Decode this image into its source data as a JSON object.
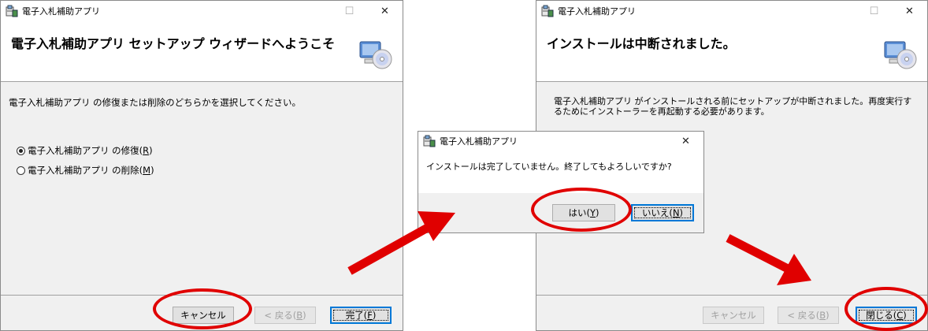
{
  "colors": {
    "highlight": "#e00000",
    "accent": "#0078d7"
  },
  "left_window": {
    "title": "電子入札補助アプリ",
    "header_title": "電子入札補助アプリ セットアップ ウィザードへようこそ",
    "instruction": "電子入札補助アプリ の修復または削除のどちらかを選択してください。",
    "options": [
      {
        "label": "電子入札補助アプリ の修復(",
        "key": "R",
        "selected": true
      },
      {
        "label": "電子入札補助アプリ の削除(",
        "key": "M",
        "selected": false
      }
    ],
    "buttons": {
      "cancel": "キャンセル",
      "back_label": "< 戻る(",
      "back_key": "B",
      "finish_label": "完了(",
      "finish_key": "F"
    }
  },
  "dialog": {
    "title": "電子入札補助アプリ",
    "message": "インストールは完了していません。終了してもよろしいですか?",
    "yes_label": "はい(",
    "yes_key": "Y",
    "no_label": "いいえ(",
    "no_key": "N"
  },
  "right_window": {
    "title": "電子入札補助アプリ",
    "header_title": "インストールは中断されました。",
    "message_line1": "電子入札補助アプリ がインストールされる前にセットアップが中断されました。再度実行す",
    "message_line2": "るためにインストーラーを再起動する必要があります。",
    "buttons": {
      "cancel": "キャンセル",
      "back_label": "< 戻る(",
      "back_key": "B",
      "close_label": "閉じる(",
      "close_key": "C"
    }
  },
  "caption": {
    "close_glyph": "✕",
    "max_glyph": "☐"
  }
}
